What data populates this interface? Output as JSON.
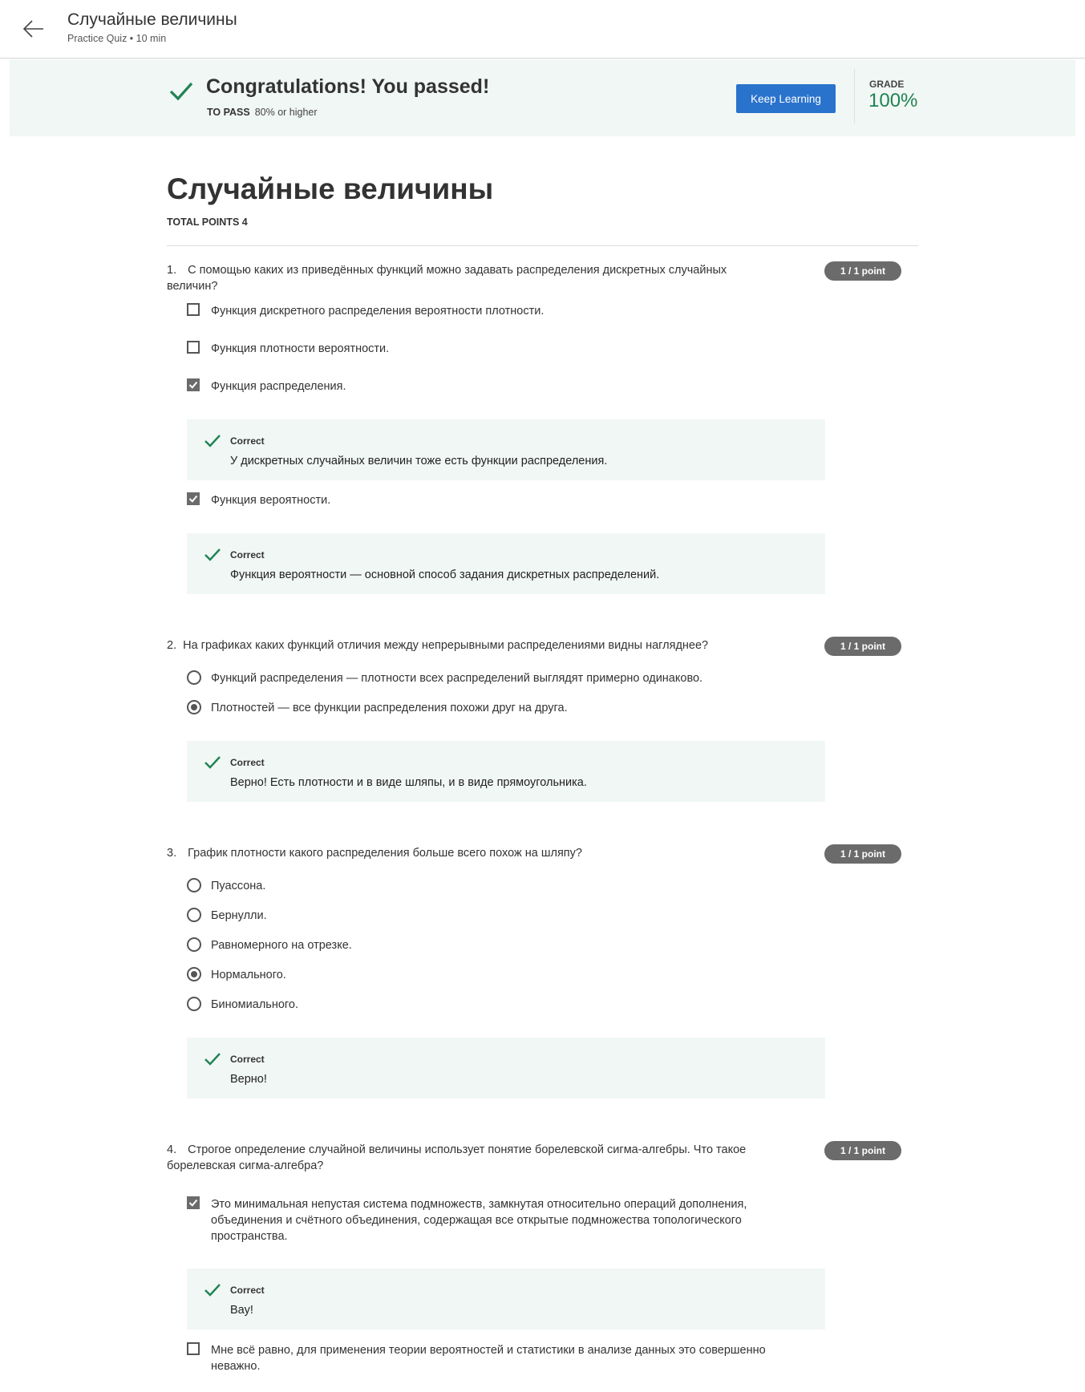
{
  "header": {
    "title": "Случайные величины",
    "subtitle": "Practice Quiz • 10 min",
    "back_icon": "arrow-left-icon"
  },
  "banner": {
    "title": "Congratulations! You passed!",
    "to_pass_label": "TO PASS",
    "to_pass_value": "80% or higher",
    "button_label": "Keep Learning",
    "grade_label": "GRADE",
    "grade_value": "100%",
    "accent_color": "#1f8354",
    "button_color": "#2a73cc"
  },
  "quiz": {
    "title": "Случайные величины",
    "total_points": "TOTAL POINTS 4"
  },
  "questions": [
    {
      "number": "1.",
      "text": "С помощью каких из приведённых функций можно задавать распределения дискретных случайных величин?",
      "points": "1 / 1 point",
      "options": [
        {
          "text": "Функция дискретного распределения вероятности плотности.",
          "checked": false
        },
        {
          "text": "Функция плотности вероятности.",
          "checked": false
        },
        {
          "text": "Функция распределения.",
          "checked": true
        },
        {
          "text": "Функция вероятности.",
          "checked": true
        }
      ],
      "feedback": [
        {
          "label": "Correct",
          "text": "У дискретных случайных величин тоже есть функции распределения."
        },
        {
          "label": "Correct",
          "text": "Функция вероятности — основной способ задания дискретных распределений."
        }
      ]
    },
    {
      "number": "2.",
      "text": "На графиках каких функций отличия между непрерывными распределениями видны нагляднее?",
      "points": "1 / 1 point",
      "options": [
        {
          "text": "Функций распределения — плотности всех распределений выглядят примерно одинаково.",
          "checked": false
        },
        {
          "text": "Плотностей — все функции распределения похожи друг на друга.",
          "checked": true
        }
      ],
      "feedback": [
        {
          "label": "Correct",
          "text": "Верно! Есть плотности и в виде шляпы, и в виде прямоугольника."
        }
      ]
    },
    {
      "number": "3.",
      "text": "График плотности какого распределения больше всего похож на шляпу?",
      "points": "1 / 1 point",
      "options": [
        {
          "text": "Пуассона.",
          "checked": false
        },
        {
          "text": "Бернулли.",
          "checked": false
        },
        {
          "text": "Равномерного на отрезке.",
          "checked": false
        },
        {
          "text": "Нормального.",
          "checked": true
        },
        {
          "text": "Биномиального.",
          "checked": false
        }
      ],
      "feedback": [
        {
          "label": "Correct",
          "text": "Верно!"
        }
      ]
    },
    {
      "number": "4.",
      "text": "Строгое определение случайной величины использует понятие борелевской сигма-алгебры. Что такое борелевская сигма-алгебра?",
      "points": "1 / 1 point",
      "options": [
        {
          "text": "Это минимальная непустая система подмножеств, замкнутая относительно операций дополнения, объединения и счётного объединения, содержащая все открытые подмножества топологического пространства.",
          "checked": true
        },
        {
          "text": "Мне всё равно, для применения теории вероятностей и статистики в анализе данных это совершенно неважно.",
          "checked": false
        }
      ],
      "feedback": [
        {
          "label": "Correct",
          "text": "Вау!"
        }
      ]
    }
  ]
}
